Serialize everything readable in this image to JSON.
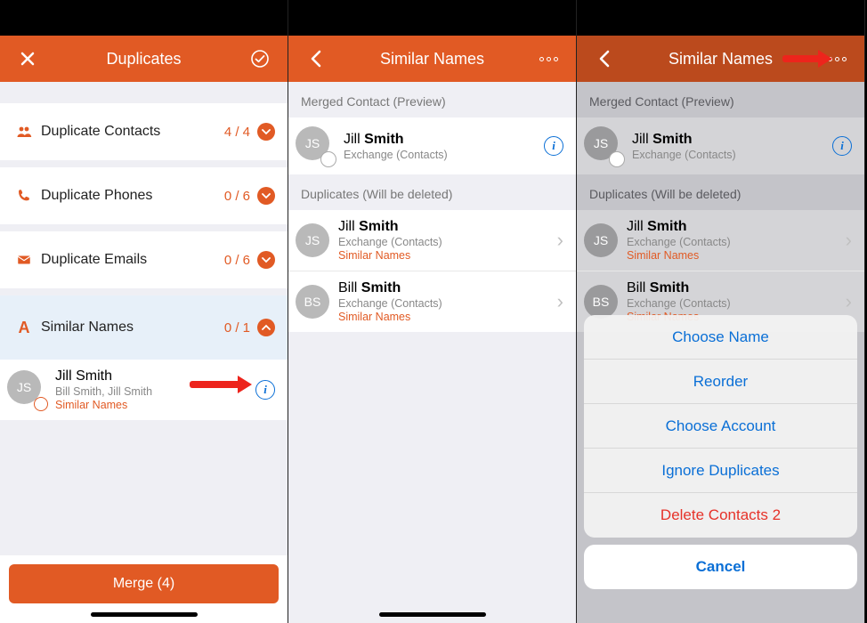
{
  "screens": {
    "s1": {
      "title": "Duplicates",
      "rows": [
        {
          "icon": "people",
          "label": "Duplicate Contacts",
          "count": "4 / 4"
        },
        {
          "icon": "phone",
          "label": "Duplicate Phones",
          "count": "0 / 6"
        },
        {
          "icon": "mail",
          "label": "Duplicate Emails",
          "count": "0 / 6"
        },
        {
          "icon": "letter",
          "label": "Similar Names",
          "count": "0 / 1"
        }
      ],
      "contact": {
        "initials": "JS",
        "name": "Jill Smith",
        "sub": "Bill Smith, Jill Smith",
        "tag": "Similar Names"
      },
      "merge_label": "Merge (4)"
    },
    "s2": {
      "title": "Similar Names",
      "section_preview": "Merged Contact (Preview)",
      "preview": {
        "initials": "JS",
        "first": "Jill",
        "last": "Smith",
        "sub": "Exchange (Contacts)"
      },
      "section_dupes": "Duplicates (Will be deleted)",
      "dupes": [
        {
          "initials": "JS",
          "first": "Jill",
          "last": "Smith",
          "sub": "Exchange (Contacts)",
          "tag": "Similar Names"
        },
        {
          "initials": "BS",
          "first": "Bill",
          "last": "Smith",
          "sub": "Exchange (Contacts)",
          "tag": "Similar Names"
        }
      ]
    },
    "s3": {
      "title": "Similar Names",
      "section_preview": "Merged Contact (Preview)",
      "preview": {
        "initials": "JS",
        "first": "Jill",
        "last": "Smith",
        "sub": "Exchange (Contacts)"
      },
      "section_dupes": "Duplicates (Will be deleted)",
      "dupes": [
        {
          "initials": "JS",
          "first": "Jill",
          "last": "Smith",
          "sub": "Exchange (Contacts)",
          "tag": "Similar Names"
        },
        {
          "initials": "BS",
          "first": "Bill",
          "last": "Smith",
          "sub": "Exchange (Contacts)",
          "tag": "Similar Names"
        }
      ],
      "sheet": {
        "items": [
          "Choose Name",
          "Reorder",
          "Choose Account",
          "Ignore Duplicates",
          "Delete Contacts 2"
        ],
        "cancel": "Cancel"
      }
    }
  },
  "colors": {
    "accent": "#e15a24",
    "info": "#0a6fd6",
    "destructive": "#e63229"
  }
}
